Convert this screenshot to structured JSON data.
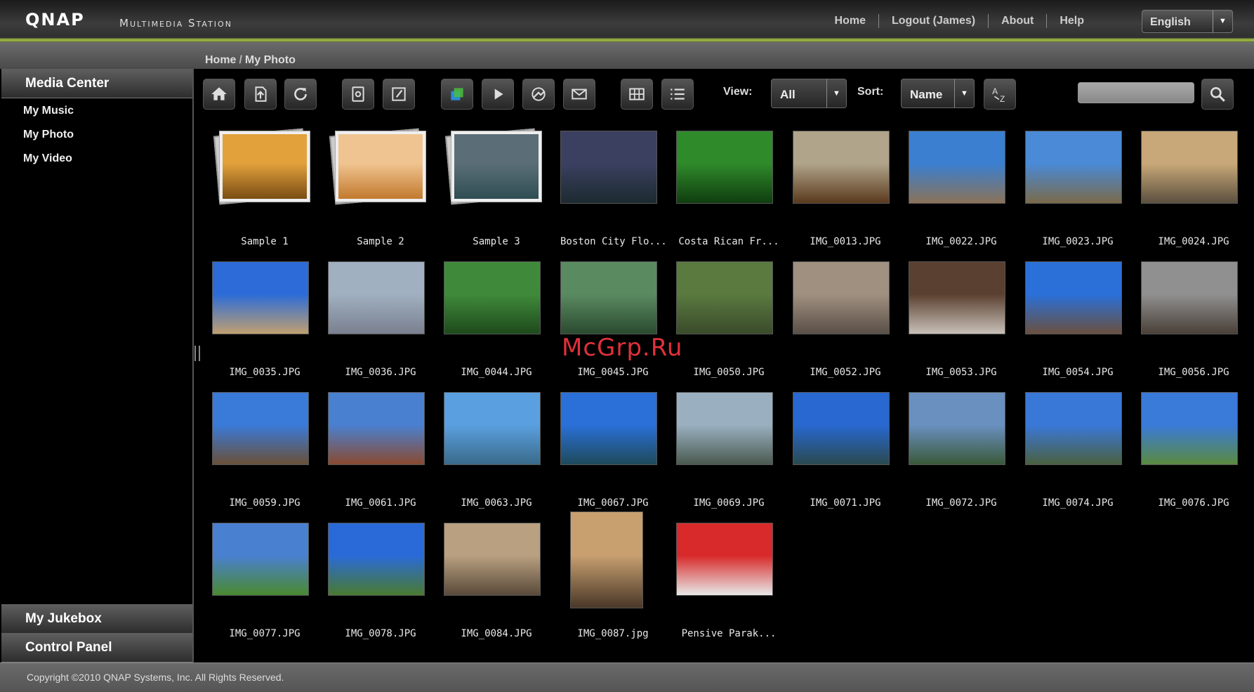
{
  "header": {
    "logo": "QNAP",
    "subtitle": "Multimedia Station",
    "nav": [
      "Home",
      "Logout (James)",
      "About",
      "Help"
    ],
    "language": "English"
  },
  "breadcrumb": {
    "home": "Home",
    "sep": "/",
    "current": "My Photo"
  },
  "sidebar": {
    "media_center": "Media Center",
    "items": [
      "My Music",
      "My Photo",
      "My Video"
    ],
    "jukebox": "My Jukebox",
    "control_panel": "Control Panel"
  },
  "toolbar": {
    "icons": [
      "home-icon",
      "upload-icon",
      "refresh-icon",
      "settings-icon",
      "edit-icon",
      "slideshow-icon",
      "play-icon",
      "share-icon",
      "mail-icon",
      "grid-view-icon",
      "list-view-icon",
      "sort-az-icon",
      "search-icon"
    ],
    "view_label": "View:",
    "view_value": "All",
    "sort_label": "Sort:",
    "sort_value": "Name",
    "search_placeholder": ""
  },
  "photos": [
    {
      "name": "Sample 1",
      "folder": true,
      "colors": [
        "#e3a13c",
        "#7a4d14"
      ]
    },
    {
      "name": "Sample 2",
      "folder": true,
      "colors": [
        "#f0c490",
        "#c27a2e"
      ]
    },
    {
      "name": "Sample 3",
      "folder": true,
      "colors": [
        "#5b6e78",
        "#2f4d53"
      ]
    },
    {
      "name": "Boston City Flo...",
      "colors": [
        "#3b4060",
        "#1c2a30"
      ]
    },
    {
      "name": "Costa Rican Fr...",
      "colors": [
        "#2f8a2a",
        "#0f3d10"
      ]
    },
    {
      "name": "IMG_0013.JPG",
      "colors": [
        "#b0a48a",
        "#5b3a1e"
      ]
    },
    {
      "name": "IMG_0022.JPG",
      "colors": [
        "#3a7fd0",
        "#8b7258"
      ]
    },
    {
      "name": "IMG_0023.JPG",
      "colors": [
        "#4a8ad6",
        "#7a6a4a"
      ]
    },
    {
      "name": "IMG_0024.JPG",
      "colors": [
        "#c8a878",
        "#5b5040"
      ]
    },
    {
      "name": "IMG_0035.JPG",
      "colors": [
        "#2c6bd8",
        "#c0a070"
      ]
    },
    {
      "name": "IMG_0036.JPG",
      "colors": [
        "#a0b0c0",
        "#7a8090"
      ]
    },
    {
      "name": "IMG_0044.JPG",
      "colors": [
        "#3f8a3a",
        "#1e4a1c"
      ]
    },
    {
      "name": "IMG_0045.JPG",
      "colors": [
        "#5a8a60",
        "#2a4a30"
      ]
    },
    {
      "name": "IMG_0050.JPG",
      "colors": [
        "#5a7a40",
        "#3a4a2a"
      ]
    },
    {
      "name": "IMG_0052.JPG",
      "colors": [
        "#a09080",
        "#5a5048"
      ]
    },
    {
      "name": "IMG_0053.JPG",
      "colors": [
        "#5a4030",
        "#c8c0b8"
      ]
    },
    {
      "name": "IMG_0054.JPG",
      "colors": [
        "#2a70d8",
        "#6a5040"
      ]
    },
    {
      "name": "IMG_0056.JPG",
      "colors": [
        "#909090",
        "#4a4038"
      ]
    },
    {
      "name": "IMG_0059.JPG",
      "colors": [
        "#3a7ad8",
        "#6a5038"
      ]
    },
    {
      "name": "IMG_0061.JPG",
      "colors": [
        "#4a80d0",
        "#8a4a30"
      ]
    },
    {
      "name": "IMG_0063.JPG",
      "colors": [
        "#5aa0e0",
        "#3a6a8a"
      ]
    },
    {
      "name": "IMG_0067.JPG",
      "colors": [
        "#2a70d8",
        "#1e4a5a"
      ]
    },
    {
      "name": "IMG_0069.JPG",
      "colors": [
        "#9ab0c0",
        "#4a5a50"
      ]
    },
    {
      "name": "IMG_0071.JPG",
      "colors": [
        "#2868d0",
        "#2a4a50"
      ]
    },
    {
      "name": "IMG_0072.JPG",
      "colors": [
        "#6a90c0",
        "#3a5a3a"
      ]
    },
    {
      "name": "IMG_0074.JPG",
      "colors": [
        "#3a78d8",
        "#4a6040"
      ]
    },
    {
      "name": "IMG_0076.JPG",
      "colors": [
        "#3a7ad8",
        "#5a8a40"
      ]
    },
    {
      "name": "IMG_0077.JPG",
      "colors": [
        "#4a80d0",
        "#4a8a30"
      ]
    },
    {
      "name": "IMG_0078.JPG",
      "colors": [
        "#2a6ad8",
        "#4a7a30"
      ]
    },
    {
      "name": "IMG_0084.JPG",
      "colors": [
        "#b8a080",
        "#5a4a3a"
      ]
    },
    {
      "name": "IMG_0087.jpg",
      "portrait": true,
      "colors": [
        "#c8a070",
        "#4a3828"
      ]
    },
    {
      "name": "Pensive Parak...",
      "colors": [
        "#d82a2a",
        "#e8e8e8"
      ]
    }
  ],
  "watermark": "McGrp.Ru",
  "footer": {
    "copyright": "Copyright ©2010 QNAP Systems, Inc. All Rights Reserved."
  }
}
